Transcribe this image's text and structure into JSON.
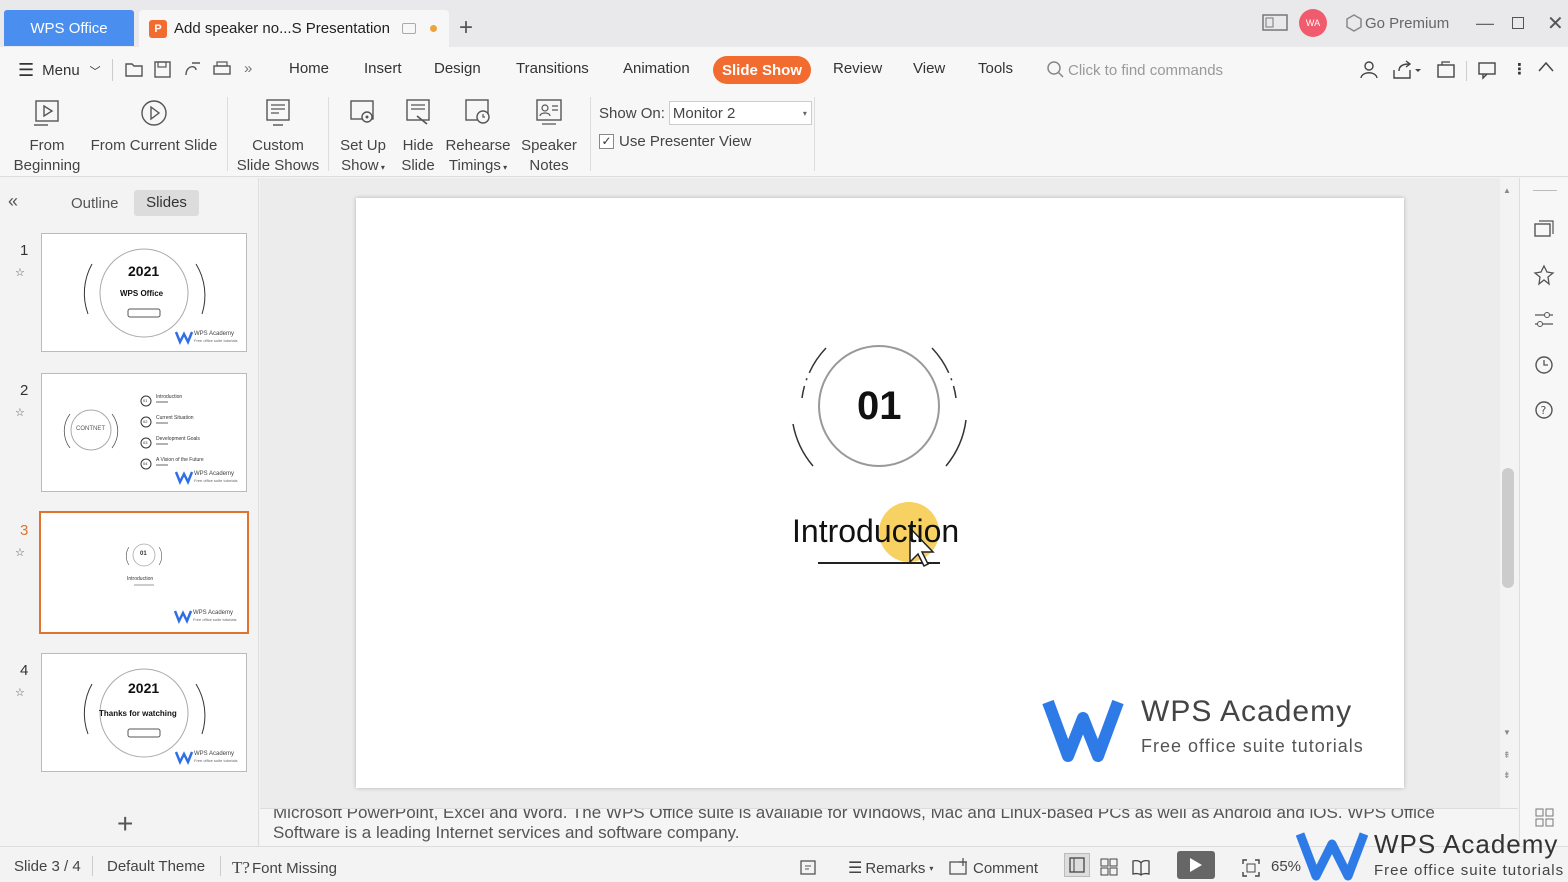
{
  "titlebar": {
    "app_tab": "WPS Office",
    "doc_tab": "Add speaker no...S Presentation",
    "premium": "Go Premium",
    "avatar": "WA"
  },
  "menu": {
    "menu_label": "Menu",
    "tabs": [
      "Home",
      "Insert",
      "Design",
      "Transitions",
      "Animation",
      "Slide Show",
      "Review",
      "View",
      "Tools"
    ],
    "active_tab": "Slide Show",
    "search_placeholder": "Click to find commands"
  },
  "ribbon": {
    "from_beginning": [
      "From",
      "Beginning"
    ],
    "from_current": "From Current Slide",
    "custom_shows": [
      "Custom",
      "Slide Shows"
    ],
    "set_up_show": [
      "Set Up",
      "Show"
    ],
    "hide_slide": [
      "Hide",
      "Slide"
    ],
    "rehearse": [
      "Rehearse",
      "Timings"
    ],
    "speaker_notes": [
      "Speaker",
      "Notes"
    ],
    "show_on_label": "Show On:",
    "show_on_value": "Monitor 2",
    "presenter_view_label": "Use Presenter View",
    "presenter_view_checked": true
  },
  "panel": {
    "tabs": [
      "Outline",
      "Slides"
    ],
    "active": "Slides",
    "slides": [
      {
        "num": "1",
        "year": "2021",
        "sub": "WPS Office"
      },
      {
        "num": "2",
        "center": "CONTNET",
        "items": [
          "Introduction",
          "Current Situation",
          "Development Goals",
          "A Vision of the Future"
        ],
        "item_nums": [
          "01",
          "02",
          "03",
          "04"
        ]
      },
      {
        "num": "3",
        "big": "01",
        "sub": "Introduction"
      },
      {
        "num": "4",
        "year": "2021",
        "sub": "Thanks for watching"
      }
    ],
    "thumb_logo": "WPS Academy",
    "thumb_logo_sub": "Free office suite tutorials",
    "selected_index": 2
  },
  "slide": {
    "number_text": "01",
    "title": "Introduction",
    "logo_title": "WPS Academy",
    "logo_subtitle": "Free office suite tutorials"
  },
  "notes": {
    "line1": "Microsoft PowerPoint, Excel and Word. The WPS Office suite is available for Windows, Mac and Linux-based PCs as well as Android and iOS. WPS Office",
    "line2": "Software is a leading Internet services and software company."
  },
  "status": {
    "slide_pos": "Slide 3 / 4",
    "theme": "Default Theme",
    "font_missing": "Font Missing",
    "remarks": "Remarks",
    "comment": "Comment",
    "zoom": "65%"
  },
  "watermark": {
    "title": "WPS Academy",
    "subtitle": "Free office suite tutorials"
  },
  "colors": {
    "accent": "#f26b2f",
    "app_tab": "#4a8ef0",
    "selected_border": "#e0732e"
  }
}
